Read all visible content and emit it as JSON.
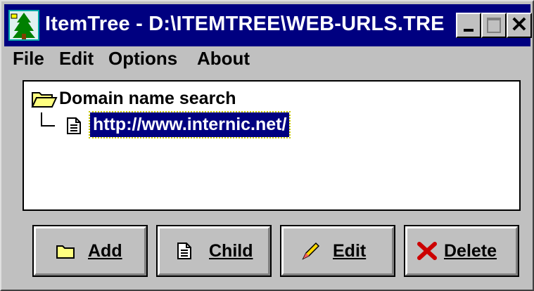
{
  "window": {
    "title": "ItemTree - D:\\ITEMTREE\\WEB-URLS.TRE",
    "close_symbol": "✕"
  },
  "menu": {
    "file": "File",
    "edit": "Edit",
    "options": "Options",
    "about": "About"
  },
  "tree": {
    "root_label": "Domain name search",
    "child_label": "http://www.internic.net/"
  },
  "buttons": {
    "add": "Add",
    "child": "Child",
    "edit": "Edit",
    "delete": "Delete"
  },
  "icons": {
    "app": "tree-app-icon",
    "folder": "open-folder-icon",
    "document": "document-icon",
    "pencil": "pencil-icon",
    "delete": "red-x-icon"
  },
  "colors": {
    "titlebar": "#000080",
    "face": "#c0c0c0",
    "selection": "#000080",
    "delete_icon": "#cc0000"
  }
}
